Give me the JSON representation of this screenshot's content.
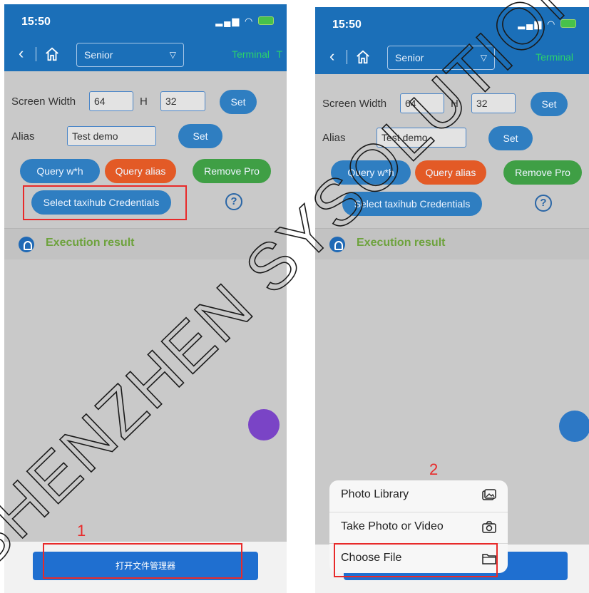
{
  "left": {
    "status": {
      "time": "15:50"
    },
    "nav": {
      "select_value": "Senior",
      "terminal": "Terminal",
      "edge": "T"
    },
    "form": {
      "screen_width_label": "Screen Width",
      "width_value": "64",
      "h_label": "H",
      "height_value": "32",
      "set_label": "Set",
      "alias_label": "Alias",
      "alias_value": "Test demo",
      "alias_set_label": "Set"
    },
    "buttons": {
      "query_wh": "Query w*h",
      "query_alias": "Query alias",
      "remove_pro": "Remove Pro",
      "select_credentials": "Select taxihub Credentials",
      "help": "?"
    },
    "result_label": "Execution result",
    "bottom_button": "打开文件管理器",
    "step": "1"
  },
  "right": {
    "status": {
      "time": "15:50"
    },
    "nav": {
      "select_value": "Senior",
      "terminal": "Terminal"
    },
    "form": {
      "screen_width_label": "Screen Width",
      "width_value": "64",
      "h_label": "H",
      "height_value": "32",
      "set_label": "Set",
      "alias_label": "Alias",
      "alias_value": "Test demo",
      "alias_set_label": "Set"
    },
    "buttons": {
      "query_wh": "Query w*h",
      "query_alias": "Query alias",
      "remove_pro": "Remove Pro",
      "select_credentials": "Select taxihub Credentials",
      "help": "?"
    },
    "result_label": "Execution result",
    "sheet": {
      "items": [
        "Photo Library",
        "Take Photo or Video",
        "Choose File"
      ]
    },
    "step": "2"
  },
  "watermark": {
    "text": "SHENZHEN SYSOLUTION TECH"
  },
  "colors": {
    "brand_blue": "#1b6fb8",
    "highlight_red": "#e82a2a",
    "result_green": "#6da23c"
  }
}
